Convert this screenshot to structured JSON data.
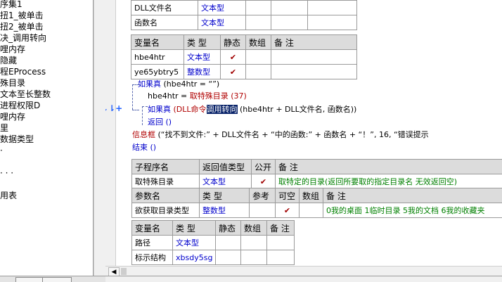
{
  "left_tree": {
    "items": [
      "序集1",
      "扭1_被单击",
      "扭2_被单击",
      "决_调用转向",
      "哩内存",
      "隐藏",
      "程EProcess",
      "殊目录",
      "文本至长整数",
      "进程权限D",
      "哩内存",
      "里",
      "数据类型",
      "·",
      "· · ·",
      "用表"
    ]
  },
  "tables": {
    "dll_params": {
      "rows": [
        {
          "name": "DLL文件名",
          "type": "文本型"
        },
        {
          "name": "函数名",
          "type": "文本型"
        }
      ]
    },
    "locals1": {
      "headers": [
        "变量名",
        "类 型",
        "静态",
        "数组",
        "备 注"
      ],
      "rows": [
        {
          "name": "hbe4htr",
          "type": "文本型",
          "static": "✔"
        },
        {
          "name": "ye65ybtry5",
          "type": "整数型",
          "static": "✔"
        }
      ]
    },
    "sub_header": {
      "headers": [
        "子程序名",
        "返回值类型",
        "公开",
        "备 注"
      ],
      "row": {
        "name": "取特殊目录",
        "ret": "文本型",
        "public": "✔",
        "note": "取特定的目录(返回所要取的指定目录名 无效返回空)"
      }
    },
    "sub_params": {
      "headers": [
        "参数名",
        "类 型",
        "参考",
        "可空",
        "数组",
        "备 注"
      ],
      "row": {
        "name": "欲获取目录类型",
        "type": "整数型",
        "nullable": "✔",
        "note": "0我的桌面 1临时目录 5我的文档 6我的收藏夹"
      }
    },
    "locals2": {
      "headers": [
        "变量名",
        "类 型",
        "静态",
        "数组",
        "备 注"
      ],
      "rows": [
        {
          "name": "路径",
          "type": "文本型"
        },
        {
          "name": "标示结构",
          "type": "xbsdy5sg"
        }
      ]
    }
  },
  "code": {
    "line1_kw": "如果真",
    "line1_rest": " (hbe4htr = “”)",
    "line2_var": "hbe4htr",
    "line2_eq": " = ",
    "line2_fn": "取特殊目录",
    "line2_arg": " (37)",
    "line3_kw": "如果真",
    "line3_fn": " (DLL命令",
    "line3_sel": "调用转向",
    "line3_rest": " (hbe4htr + DLL文件名, 函数名))",
    "line4_kw": "返回",
    "line4_rest": " ()",
    "line5_fn": "信息框",
    "line5_rest": " (“找不到文件:” + DLL文件名 + “中的函数:” + 函数名 + “！”, 16, “错误提示",
    "line6_kw": "结束",
    "line6_rest": " ()",
    "gutter_controls": "⇣⇂+"
  },
  "scroll": {
    "left_arrow": "◀"
  }
}
